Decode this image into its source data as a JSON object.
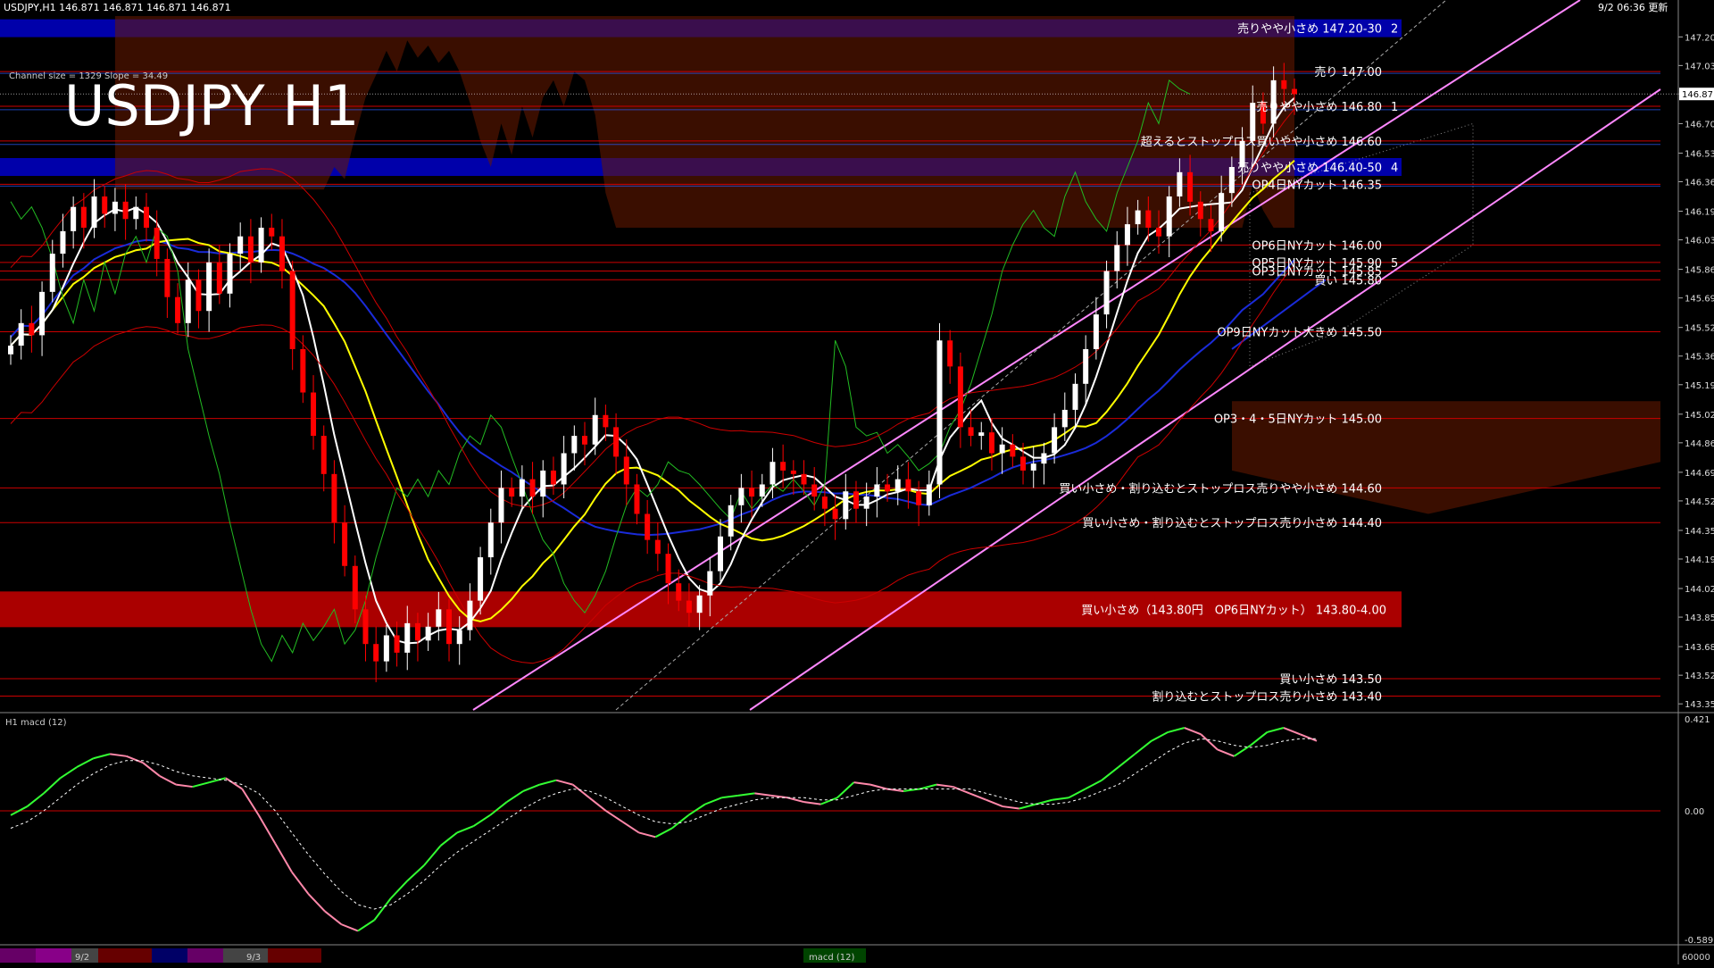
{
  "header": {
    "symbol_info": "USDJPY,H1  146.871  146.871  146.871  146.871",
    "timestamp": "9/2 06:36 更新",
    "channel_info": "Channel size = 1329 Slope = 34.49",
    "title": "USDJPY H1"
  },
  "colors": {
    "background": "#000000",
    "bull": "#ffffff",
    "bear": "#ff0000",
    "ma_white": "#ffffff",
    "ma_yellow": "#ffff00",
    "ma_blue": "#1a2bd9",
    "green_line": "#22bb22",
    "channel": "#ff88ff",
    "level_line": "#cc0000",
    "blue_band": "#0000aa",
    "red_band": "#aa0000",
    "macd_up": "#33ff33",
    "macd_down": "#ff88aa"
  },
  "chart_data": [
    {
      "type": "candlestick",
      "title": "USDJPY H1",
      "y_axis_ticks": [
        "147.200",
        "147.035",
        "146.871",
        "146.700",
        "146.530",
        "146.365",
        "146.195",
        "146.030",
        "145.860",
        "145.695",
        "145.525",
        "145.360",
        "145.195",
        "145.025",
        "144.860",
        "144.690",
        "144.525",
        "144.355",
        "144.190",
        "144.020",
        "143.855",
        "143.685",
        "143.520",
        "143.355"
      ],
      "current_price": "146.871",
      "ylim": [
        143.32,
        147.32
      ],
      "levels": [
        {
          "price": 147.25,
          "label": "売りやや小さめ 147.20-30",
          "style": "blue_band",
          "marker": "2"
        },
        {
          "price": 147.0,
          "label": "売り 147.00",
          "style": "line"
        },
        {
          "price": 146.8,
          "label": "売りやや小さめ 146.80",
          "style": "line",
          "marker": "1"
        },
        {
          "price": 146.6,
          "label": "超えるとストップロス買いやや小さめ 146.60",
          "style": "line"
        },
        {
          "price": 146.45,
          "label": "売りやや小さめ 146.40-50",
          "style": "blue_band",
          "marker": "4"
        },
        {
          "price": 146.35,
          "label": "OP4日NYカット 146.35",
          "style": "line"
        },
        {
          "price": 146.0,
          "label": "OP6日NYカット 146.00",
          "style": "line"
        },
        {
          "price": 145.9,
          "label": "OP5日NYカット 145.90",
          "style": "line",
          "marker": "5"
        },
        {
          "price": 145.85,
          "label": "OP3日NYカット 145.85",
          "style": "line"
        },
        {
          "price": 145.8,
          "label": "買い 145.80",
          "style": "line"
        },
        {
          "price": 145.5,
          "label": "OP9日NYカット大きめ 145.50",
          "style": "line"
        },
        {
          "price": 145.0,
          "label": "OP3・4・5日NYカット 145.00",
          "style": "line"
        },
        {
          "price": 144.6,
          "label": "買い小さめ・割り込むとストップロス売りやや小さめ 144.60",
          "style": "line"
        },
        {
          "price": 144.4,
          "label": "買い小さめ・割り込むとストップロス売り小さめ 144.40",
          "style": "line"
        },
        {
          "price": 143.9,
          "label": "買い小さめ（143.80円　OP6日NYカット） 143.80-4.00",
          "style": "red_band"
        },
        {
          "price": 143.5,
          "label": "買い小さめ 143.50",
          "style": "line"
        },
        {
          "price": 143.4,
          "label": "割り込むとストップロス売り小さめ 143.40",
          "style": "line"
        }
      ],
      "close_series": [
        145.42,
        145.55,
        145.48,
        145.73,
        145.95,
        146.08,
        146.22,
        146.1,
        146.28,
        146.18,
        146.25,
        146.15,
        146.22,
        146.1,
        145.92,
        145.7,
        145.55,
        145.8,
        145.62,
        145.9,
        145.72,
        145.95,
        146.05,
        145.9,
        146.1,
        146.05,
        145.85,
        145.4,
        145.15,
        144.9,
        144.68,
        144.4,
        144.15,
        143.9,
        143.7,
        143.6,
        143.75,
        143.65,
        143.82,
        143.72,
        143.8,
        143.9,
        143.7,
        143.78,
        143.95,
        144.2,
        144.4,
        144.6,
        144.55,
        144.65,
        144.55,
        144.7,
        144.62,
        144.8,
        144.9,
        144.85,
        145.02,
        144.95,
        144.78,
        144.62,
        144.45,
        144.3,
        144.22,
        144.05,
        143.95,
        143.88,
        143.98,
        144.12,
        144.32,
        144.5,
        144.6,
        144.55,
        144.62,
        144.75,
        144.7,
        144.68,
        144.62,
        144.55,
        144.48,
        144.42,
        144.58,
        144.48,
        144.55,
        144.62,
        144.58,
        144.65,
        144.58,
        144.5,
        144.62,
        145.45,
        145.3,
        144.95,
        144.9,
        144.92,
        144.8,
        144.85,
        144.78,
        144.7,
        144.74,
        144.8,
        144.95,
        145.05,
        145.2,
        145.4,
        145.6,
        145.85,
        146.0,
        146.12,
        146.2,
        146.1,
        146.05,
        146.28,
        146.42,
        146.25,
        146.15,
        146.08,
        146.3,
        146.45,
        146.6,
        146.82,
        146.7,
        146.95,
        146.9,
        146.87
      ],
      "macd": {
        "name": "macd (12)",
        "panel_label": "H1  macd (12)",
        "y_axis_ticks": [
          "0.421",
          "0.00",
          "-0.589"
        ],
        "ylim": [
          -0.589,
          0.421
        ],
        "zero_line": 0,
        "values": [
          -0.02,
          0.02,
          0.08,
          0.15,
          0.2,
          0.24,
          0.26,
          0.25,
          0.22,
          0.16,
          0.12,
          0.11,
          0.13,
          0.15,
          0.1,
          -0.02,
          -0.15,
          -0.28,
          -0.38,
          -0.46,
          -0.52,
          -0.55,
          -0.5,
          -0.4,
          -0.32,
          -0.25,
          -0.16,
          -0.1,
          -0.07,
          -0.02,
          0.04,
          0.09,
          0.12,
          0.14,
          0.12,
          0.06,
          0.0,
          -0.05,
          -0.1,
          -0.12,
          -0.08,
          -0.02,
          0.03,
          0.06,
          0.07,
          0.08,
          0.07,
          0.06,
          0.04,
          0.03,
          0.06,
          0.13,
          0.12,
          0.1,
          0.09,
          0.1,
          0.12,
          0.11,
          0.08,
          0.05,
          0.02,
          0.01,
          0.03,
          0.05,
          0.06,
          0.1,
          0.14,
          0.2,
          0.26,
          0.32,
          0.36,
          0.38,
          0.35,
          0.28,
          0.25,
          0.3,
          0.36,
          0.38,
          0.35,
          0.32
        ],
        "signal": [
          -0.08,
          -0.05,
          0.0,
          0.06,
          0.12,
          0.17,
          0.21,
          0.23,
          0.23,
          0.21,
          0.18,
          0.16,
          0.15,
          0.14,
          0.12,
          0.08,
          0.0,
          -0.1,
          -0.2,
          -0.29,
          -0.37,
          -0.43,
          -0.45,
          -0.43,
          -0.38,
          -0.32,
          -0.25,
          -0.19,
          -0.14,
          -0.09,
          -0.04,
          0.01,
          0.05,
          0.08,
          0.1,
          0.09,
          0.06,
          0.02,
          -0.02,
          -0.05,
          -0.06,
          -0.05,
          -0.02,
          0.01,
          0.03,
          0.05,
          0.06,
          0.06,
          0.06,
          0.05,
          0.05,
          0.07,
          0.09,
          0.1,
          0.1,
          0.1,
          0.1,
          0.1,
          0.1,
          0.08,
          0.06,
          0.04,
          0.03,
          0.03,
          0.04,
          0.06,
          0.09,
          0.12,
          0.17,
          0.22,
          0.27,
          0.31,
          0.33,
          0.32,
          0.3,
          0.29,
          0.3,
          0.32,
          0.33,
          0.33
        ]
      }
    }
  ],
  "bottom_bar": {
    "date_labels": [
      "9/2",
      "9/3"
    ],
    "indicator_tab": "macd (12)",
    "right_value": "60000"
  }
}
